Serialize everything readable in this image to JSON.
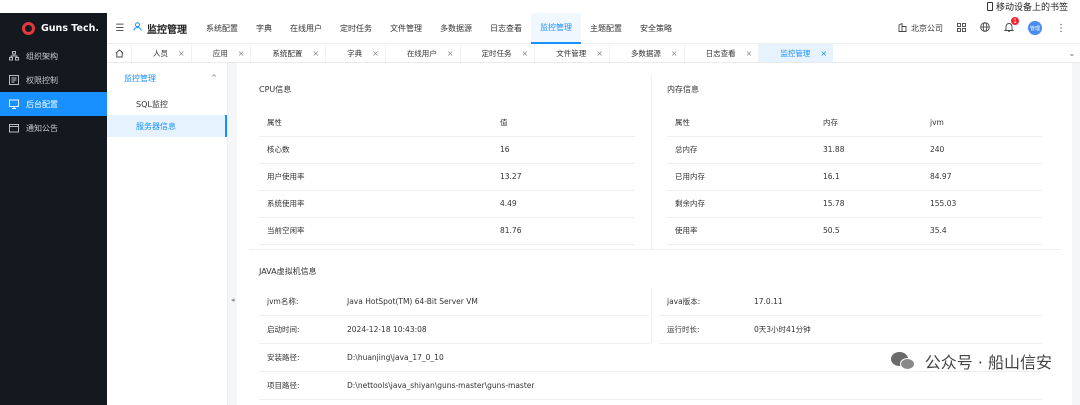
{
  "bookmark": {
    "label": "移动设备上的书签"
  },
  "brand": {
    "name": "Guns Tech."
  },
  "sidebar": {
    "items": [
      {
        "label": "组织架构",
        "icon": "org-icon"
      },
      {
        "label": "权限控制",
        "icon": "permission-icon"
      },
      {
        "label": "后台配置",
        "icon": "config-icon",
        "active": true
      },
      {
        "label": "通知公告",
        "icon": "notice-icon"
      }
    ]
  },
  "topnav": {
    "module": "监控管理",
    "menu": [
      "系统配置",
      "字典",
      "在线用户",
      "定时任务",
      "文件管理",
      "多数据源",
      "日志查看",
      "监控管理",
      "主题配置",
      "安全策略"
    ],
    "active_menu": "监控管理",
    "company": "北京公司",
    "notification_count": "1",
    "avatar_label": "管理"
  },
  "tabs": {
    "items": [
      "人员",
      "应用",
      "系统配置",
      "字典",
      "在线用户",
      "定时任务",
      "文件管理",
      "多数据源",
      "日志查看",
      "监控管理"
    ],
    "active": "监控管理"
  },
  "submenu": {
    "group": "监控管理",
    "items": [
      "SQL监控",
      "服务器信息"
    ],
    "active": "服务器信息"
  },
  "cpu": {
    "title": "CPU信息",
    "headers": [
      "属性",
      "值"
    ],
    "rows": [
      [
        "核心数",
        "16"
      ],
      [
        "用户使用率",
        "13.27"
      ],
      [
        "系统使用率",
        "4.49"
      ],
      [
        "当前空闲率",
        "81.76"
      ]
    ]
  },
  "memory": {
    "title": "内存信息",
    "headers": [
      "属性",
      "内存",
      "jvm"
    ],
    "rows": [
      [
        "总内存",
        "31.88",
        "240"
      ],
      [
        "已用内存",
        "16.1",
        "84.97"
      ],
      [
        "剩余内存",
        "15.78",
        "155.03"
      ],
      [
        "使用率",
        "50.5",
        "35.4"
      ]
    ]
  },
  "jvm": {
    "title": "JAVA虚拟机信息",
    "name_label": "jvm名称:",
    "name_value": "Java HotSpot(TM) 64-Bit Server VM",
    "version_label": "java版本:",
    "version_value": "17.0.11",
    "start_label": "启动时间:",
    "start_value": "2024-12-18 10:43:08",
    "uptime_label": "运行时长:",
    "uptime_value": "0天3小时41分钟",
    "install_label": "安装路径:",
    "install_value": "D:\\huanjing\\java_17_0_10",
    "project_label": "项目路径:",
    "project_value": "D:\\nettools\\java_shiyan\\guns-master\\guns-master"
  },
  "watermark": {
    "text": "公众号 · 船山信安"
  },
  "colors": {
    "accent": "#1890ff",
    "sidebar_bg": "#14181f",
    "badge": "#f5222d"
  }
}
